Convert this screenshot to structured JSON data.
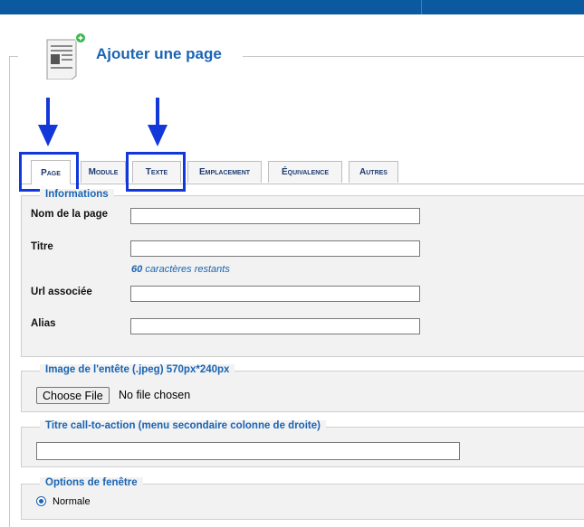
{
  "header": {
    "title": "Ajouter une page"
  },
  "tabs": [
    {
      "label": "Page",
      "active": true
    },
    {
      "label": "Module",
      "active": false
    },
    {
      "label": "Texte",
      "active": false
    },
    {
      "label": "Emplacement",
      "active": false
    },
    {
      "label": "Équivalence",
      "active": false
    },
    {
      "label": "Autres",
      "active": false
    }
  ],
  "informations": {
    "legend": "Informations",
    "fields": [
      {
        "label": "Nom de la page",
        "value": ""
      },
      {
        "label": "Titre",
        "value": ""
      },
      {
        "label": "Url associée",
        "value": ""
      },
      {
        "label": "Alias",
        "value": ""
      }
    ],
    "counter_number": "60",
    "counter_text": "caractères restants"
  },
  "image_header": {
    "legend": "Image de l'entête (.jpeg) 570px*240px",
    "button_label": "Choose File",
    "file_status": "No file chosen"
  },
  "cta": {
    "legend": "Titre call-to-action (menu secondaire colonne de droite)",
    "value": ""
  },
  "window_options": {
    "legend": "Options de fenêtre",
    "radio_label": "Normale",
    "selected": true
  },
  "colors": {
    "accent": "#1a64b4",
    "topbar": "#0b5aa0",
    "highlight": "#1238d9"
  },
  "icons": [
    "add-page-icon",
    "arrow-down-icon"
  ]
}
